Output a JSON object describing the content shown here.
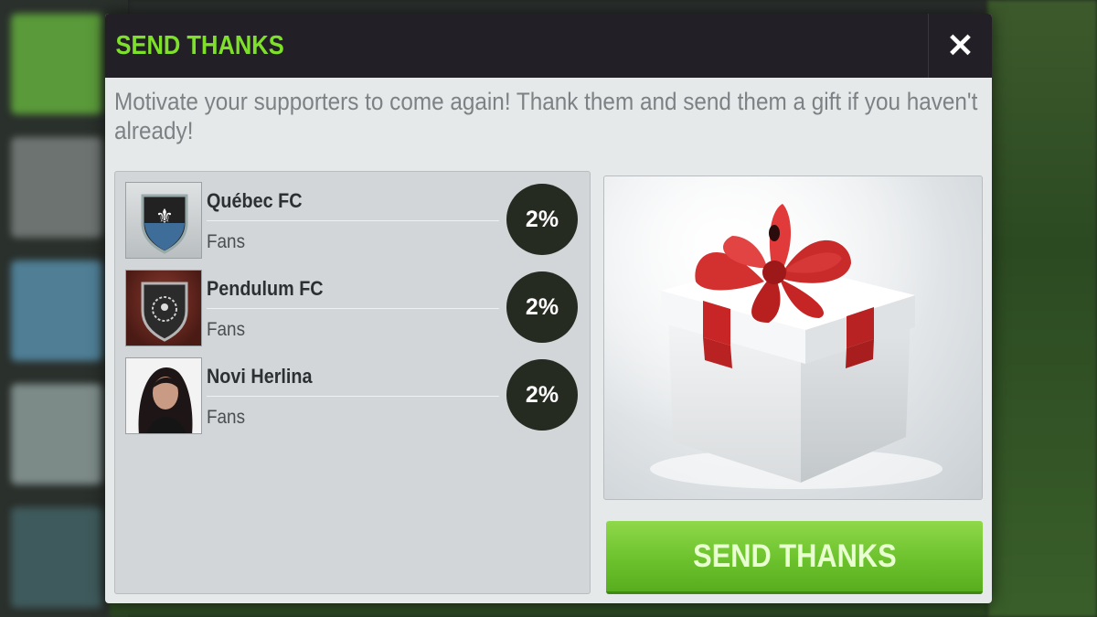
{
  "dialog": {
    "title": "SEND THANKS",
    "close_label": "✕",
    "intro": "Motivate your supporters to come again! Thank them and send them a gift if you haven't already!"
  },
  "supporters": [
    {
      "name": "Québec FC",
      "role": "Fans",
      "percent": "2%",
      "avatar": "quebec-fc-crest-icon"
    },
    {
      "name": "Pendulum FC",
      "role": "Fans",
      "percent": "2%",
      "avatar": "pendulum-fc-crest-icon"
    },
    {
      "name": "Novi Herlina",
      "role": "Fans",
      "percent": "2%",
      "avatar": "user-photo"
    }
  ],
  "gift": {
    "icon": "gift-box-icon",
    "box_color": "#f0f1f2",
    "ribbon_color": "#d42a2a"
  },
  "actions": {
    "send_label": "SEND THANKS"
  },
  "colors": {
    "title_green": "#7ee02b",
    "button_green": "#6cc22d",
    "header_dark": "#221f26"
  }
}
